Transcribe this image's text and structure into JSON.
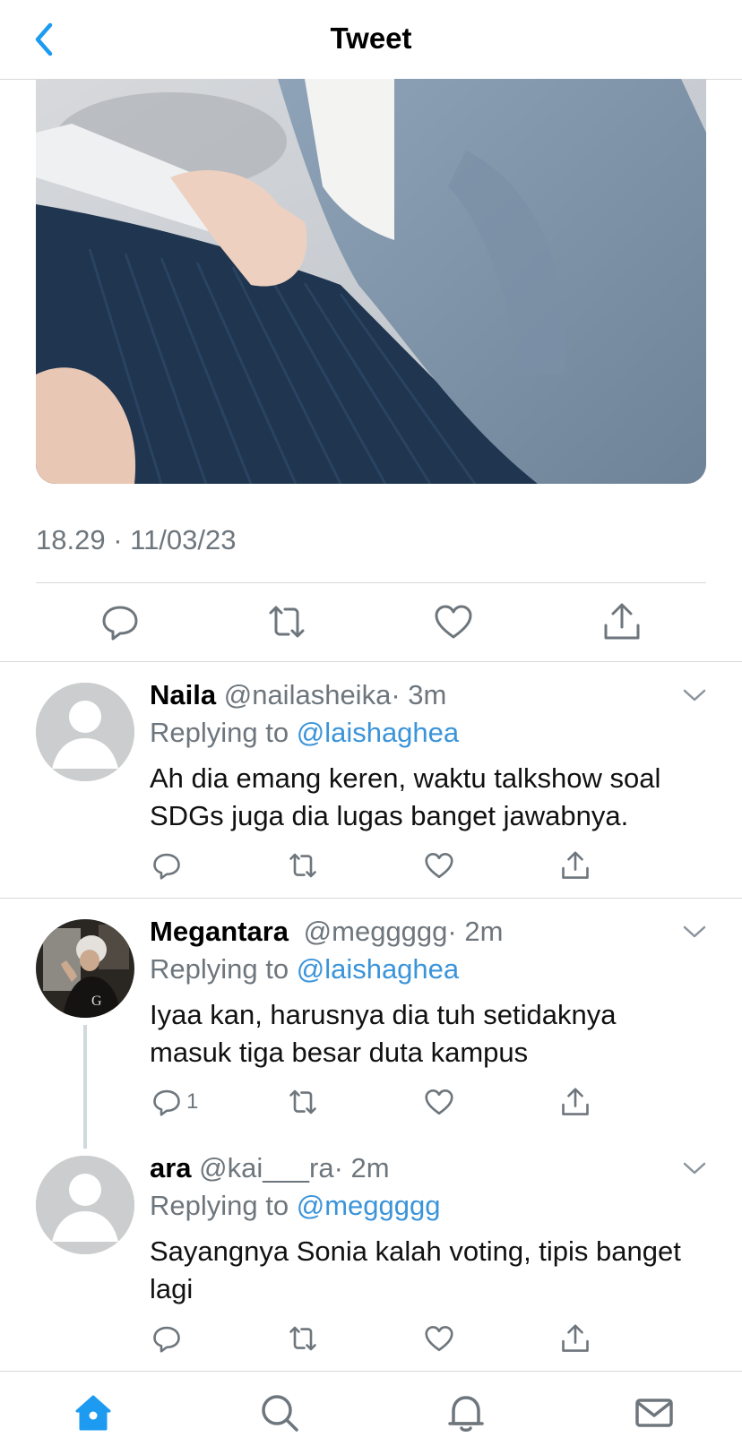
{
  "header": {
    "title": "Tweet"
  },
  "tweet": {
    "timestamp": "18.29 · 11/03/23"
  },
  "replies": [
    {
      "name": "Naila",
      "handle": "@nailasheika",
      "time": "· 3m",
      "replying_label": "Replying to",
      "replying_to": "@laishaghea",
      "text": "Ah dia emang keren, waktu talkshow soal SDGs juga dia lugas banget jawabnya."
    },
    {
      "name": "Megantara",
      "handle": "@meggggg",
      "time": "· 2m",
      "replying_label": "Replying to",
      "replying_to": "@laishaghea",
      "text": "Iyaa kan, harusnya dia tuh setidaknya masuk tiga besar duta kampus",
      "reply_count": "1"
    },
    {
      "name": "ara",
      "handle": "@kai___ra",
      "time": "· 2m",
      "replying_label": "Replying to",
      "replying_to": "@meggggg",
      "text": "Sayangnya Sonia kalah voting, tipis banget lagi"
    }
  ],
  "colors": {
    "accent": "#1d9bf0",
    "link": "#3b94d9",
    "muted": "#6e767d"
  },
  "icons": [
    "back-icon",
    "reply-icon",
    "retweet-icon",
    "like-icon",
    "share-icon",
    "chevron-down-icon",
    "home-icon",
    "search-icon",
    "notifications-icon",
    "messages-icon"
  ]
}
